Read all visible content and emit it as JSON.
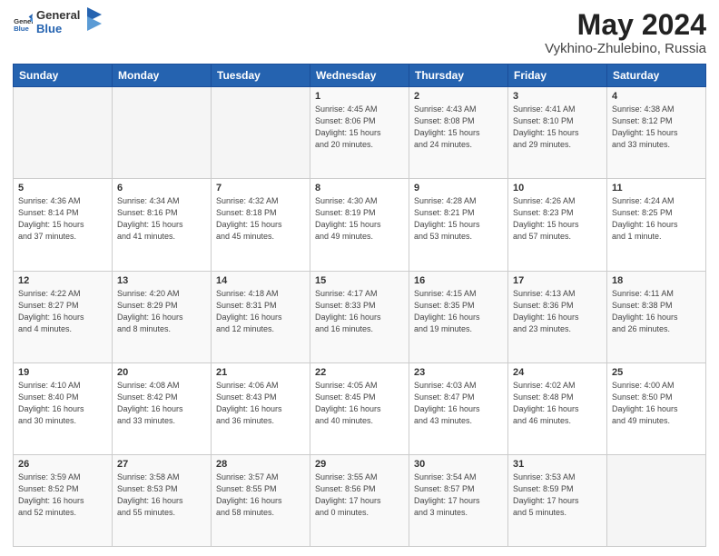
{
  "header": {
    "logo_line1": "General",
    "logo_line2": "Blue",
    "month_year": "May 2024",
    "location": "Vykhino-Zhulebino, Russia"
  },
  "weekdays": [
    "Sunday",
    "Monday",
    "Tuesday",
    "Wednesday",
    "Thursday",
    "Friday",
    "Saturday"
  ],
  "weeks": [
    [
      {
        "day": "",
        "info": ""
      },
      {
        "day": "",
        "info": ""
      },
      {
        "day": "",
        "info": ""
      },
      {
        "day": "1",
        "info": "Sunrise: 4:45 AM\nSunset: 8:06 PM\nDaylight: 15 hours\nand 20 minutes."
      },
      {
        "day": "2",
        "info": "Sunrise: 4:43 AM\nSunset: 8:08 PM\nDaylight: 15 hours\nand 24 minutes."
      },
      {
        "day": "3",
        "info": "Sunrise: 4:41 AM\nSunset: 8:10 PM\nDaylight: 15 hours\nand 29 minutes."
      },
      {
        "day": "4",
        "info": "Sunrise: 4:38 AM\nSunset: 8:12 PM\nDaylight: 15 hours\nand 33 minutes."
      }
    ],
    [
      {
        "day": "5",
        "info": "Sunrise: 4:36 AM\nSunset: 8:14 PM\nDaylight: 15 hours\nand 37 minutes."
      },
      {
        "day": "6",
        "info": "Sunrise: 4:34 AM\nSunset: 8:16 PM\nDaylight: 15 hours\nand 41 minutes."
      },
      {
        "day": "7",
        "info": "Sunrise: 4:32 AM\nSunset: 8:18 PM\nDaylight: 15 hours\nand 45 minutes."
      },
      {
        "day": "8",
        "info": "Sunrise: 4:30 AM\nSunset: 8:19 PM\nDaylight: 15 hours\nand 49 minutes."
      },
      {
        "day": "9",
        "info": "Sunrise: 4:28 AM\nSunset: 8:21 PM\nDaylight: 15 hours\nand 53 minutes."
      },
      {
        "day": "10",
        "info": "Sunrise: 4:26 AM\nSunset: 8:23 PM\nDaylight: 15 hours\nand 57 minutes."
      },
      {
        "day": "11",
        "info": "Sunrise: 4:24 AM\nSunset: 8:25 PM\nDaylight: 16 hours\nand 1 minute."
      }
    ],
    [
      {
        "day": "12",
        "info": "Sunrise: 4:22 AM\nSunset: 8:27 PM\nDaylight: 16 hours\nand 4 minutes."
      },
      {
        "day": "13",
        "info": "Sunrise: 4:20 AM\nSunset: 8:29 PM\nDaylight: 16 hours\nand 8 minutes."
      },
      {
        "day": "14",
        "info": "Sunrise: 4:18 AM\nSunset: 8:31 PM\nDaylight: 16 hours\nand 12 minutes."
      },
      {
        "day": "15",
        "info": "Sunrise: 4:17 AM\nSunset: 8:33 PM\nDaylight: 16 hours\nand 16 minutes."
      },
      {
        "day": "16",
        "info": "Sunrise: 4:15 AM\nSunset: 8:35 PM\nDaylight: 16 hours\nand 19 minutes."
      },
      {
        "day": "17",
        "info": "Sunrise: 4:13 AM\nSunset: 8:36 PM\nDaylight: 16 hours\nand 23 minutes."
      },
      {
        "day": "18",
        "info": "Sunrise: 4:11 AM\nSunset: 8:38 PM\nDaylight: 16 hours\nand 26 minutes."
      }
    ],
    [
      {
        "day": "19",
        "info": "Sunrise: 4:10 AM\nSunset: 8:40 PM\nDaylight: 16 hours\nand 30 minutes."
      },
      {
        "day": "20",
        "info": "Sunrise: 4:08 AM\nSunset: 8:42 PM\nDaylight: 16 hours\nand 33 minutes."
      },
      {
        "day": "21",
        "info": "Sunrise: 4:06 AM\nSunset: 8:43 PM\nDaylight: 16 hours\nand 36 minutes."
      },
      {
        "day": "22",
        "info": "Sunrise: 4:05 AM\nSunset: 8:45 PM\nDaylight: 16 hours\nand 40 minutes."
      },
      {
        "day": "23",
        "info": "Sunrise: 4:03 AM\nSunset: 8:47 PM\nDaylight: 16 hours\nand 43 minutes."
      },
      {
        "day": "24",
        "info": "Sunrise: 4:02 AM\nSunset: 8:48 PM\nDaylight: 16 hours\nand 46 minutes."
      },
      {
        "day": "25",
        "info": "Sunrise: 4:00 AM\nSunset: 8:50 PM\nDaylight: 16 hours\nand 49 minutes."
      }
    ],
    [
      {
        "day": "26",
        "info": "Sunrise: 3:59 AM\nSunset: 8:52 PM\nDaylight: 16 hours\nand 52 minutes."
      },
      {
        "day": "27",
        "info": "Sunrise: 3:58 AM\nSunset: 8:53 PM\nDaylight: 16 hours\nand 55 minutes."
      },
      {
        "day": "28",
        "info": "Sunrise: 3:57 AM\nSunset: 8:55 PM\nDaylight: 16 hours\nand 58 minutes."
      },
      {
        "day": "29",
        "info": "Sunrise: 3:55 AM\nSunset: 8:56 PM\nDaylight: 17 hours\nand 0 minutes."
      },
      {
        "day": "30",
        "info": "Sunrise: 3:54 AM\nSunset: 8:57 PM\nDaylight: 17 hours\nand 3 minutes."
      },
      {
        "day": "31",
        "info": "Sunrise: 3:53 AM\nSunset: 8:59 PM\nDaylight: 17 hours\nand 5 minutes."
      },
      {
        "day": "",
        "info": ""
      }
    ]
  ]
}
